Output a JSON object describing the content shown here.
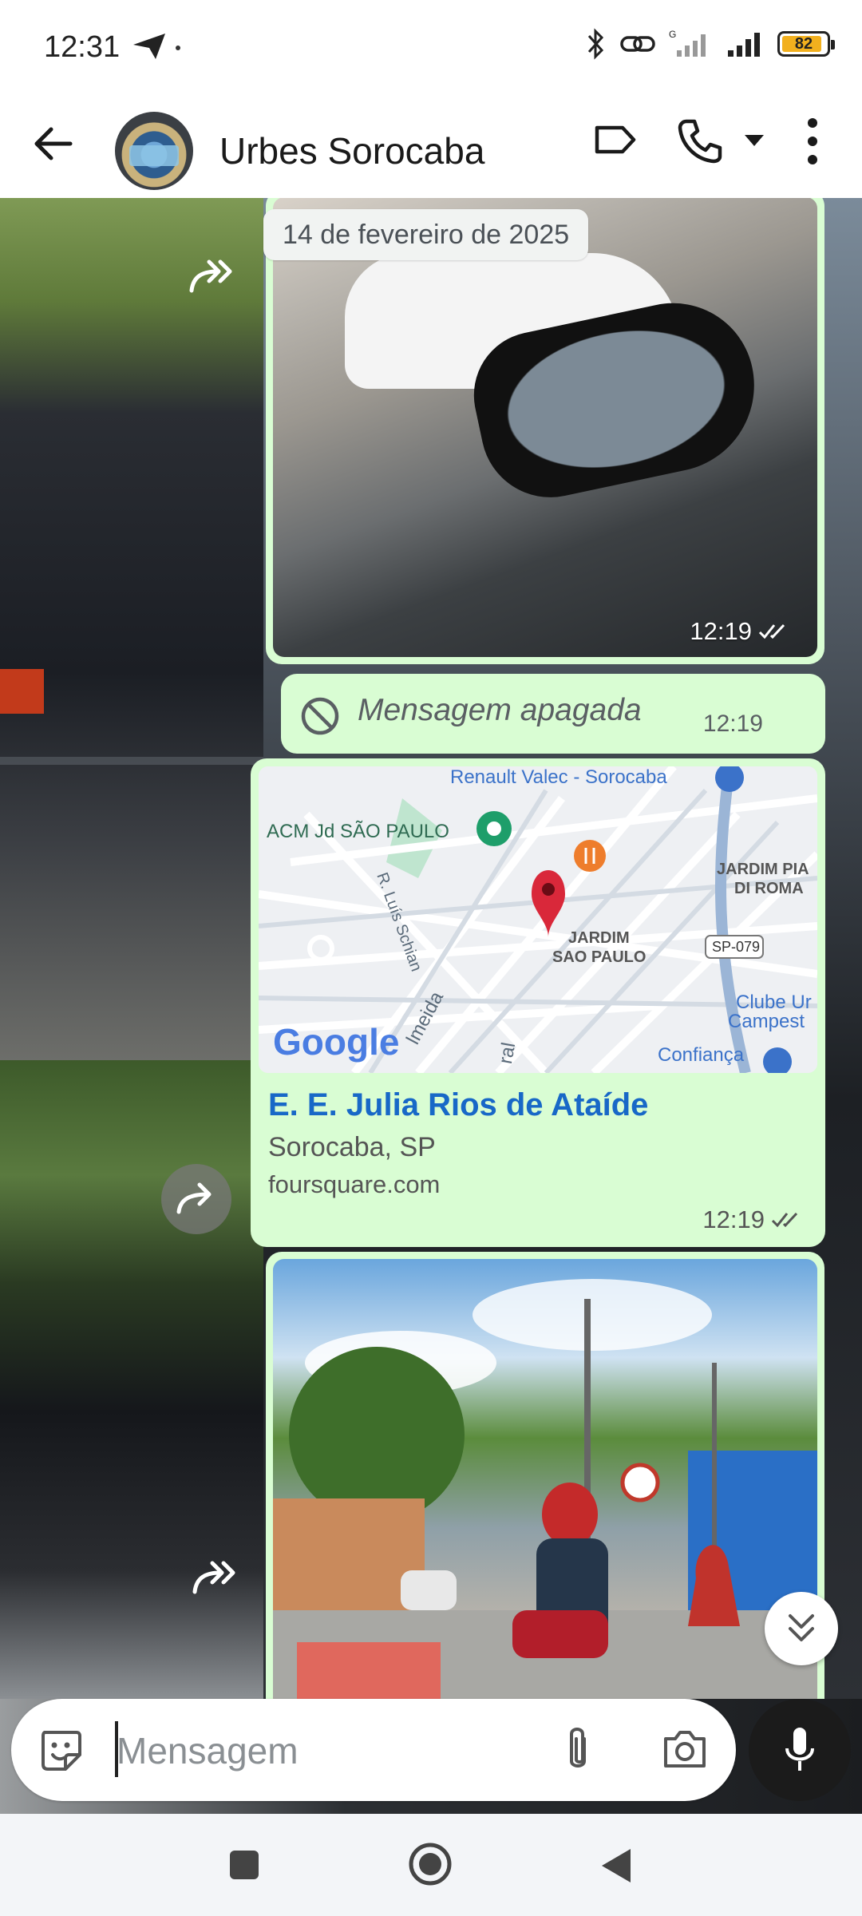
{
  "status_bar": {
    "time": "12:31",
    "battery_level": "82",
    "icons": [
      "telegram-send-icon",
      "bluetooth-icon",
      "link-icon",
      "signal-g-icon",
      "signal-icon",
      "battery-icon"
    ]
  },
  "header": {
    "chat_name": "Urbes Sorocaba",
    "icons": [
      "back-arrow-icon",
      "label-icon",
      "phone-icon",
      "caret-down-icon",
      "more-vert-icon"
    ]
  },
  "chat": {
    "date_chip": "14 de fevereiro de 2025",
    "messages": [
      {
        "type": "image",
        "time": "12:19",
        "status": "read"
      },
      {
        "type": "deleted",
        "text": "Mensagem apagada",
        "time": "12:19"
      },
      {
        "type": "location",
        "title": "E. E. Julia Rios de Ataíde",
        "subtitle": "Sorocaba, SP",
        "domain": "foursquare.com",
        "time": "12:19",
        "status": "read",
        "map_labels": {
          "renault": "Renault Valec - Sorocaba",
          "acm": "ACM Jd SÃO PAULO",
          "jardim_pia": "JARDIM PIA",
          "di_roma": "DI ROMA",
          "jardim": "JARDIM",
          "sao_paulo": "SAO PAULO",
          "sp079": "SP-079",
          "luis": "R. Luís Schian",
          "clube": "Clube Ur",
          "campest": "Campest",
          "confianca": "Confiança",
          "almeida": "lmeida",
          "ral": "ral",
          "google": "Google"
        }
      },
      {
        "type": "image"
      }
    ]
  },
  "input": {
    "placeholder": "Mensagem",
    "value": ""
  },
  "colors": {
    "bubble_outgoing": "#d9fdd3",
    "link_title": "#1868c7",
    "read_ticks": "#53bdeb"
  }
}
